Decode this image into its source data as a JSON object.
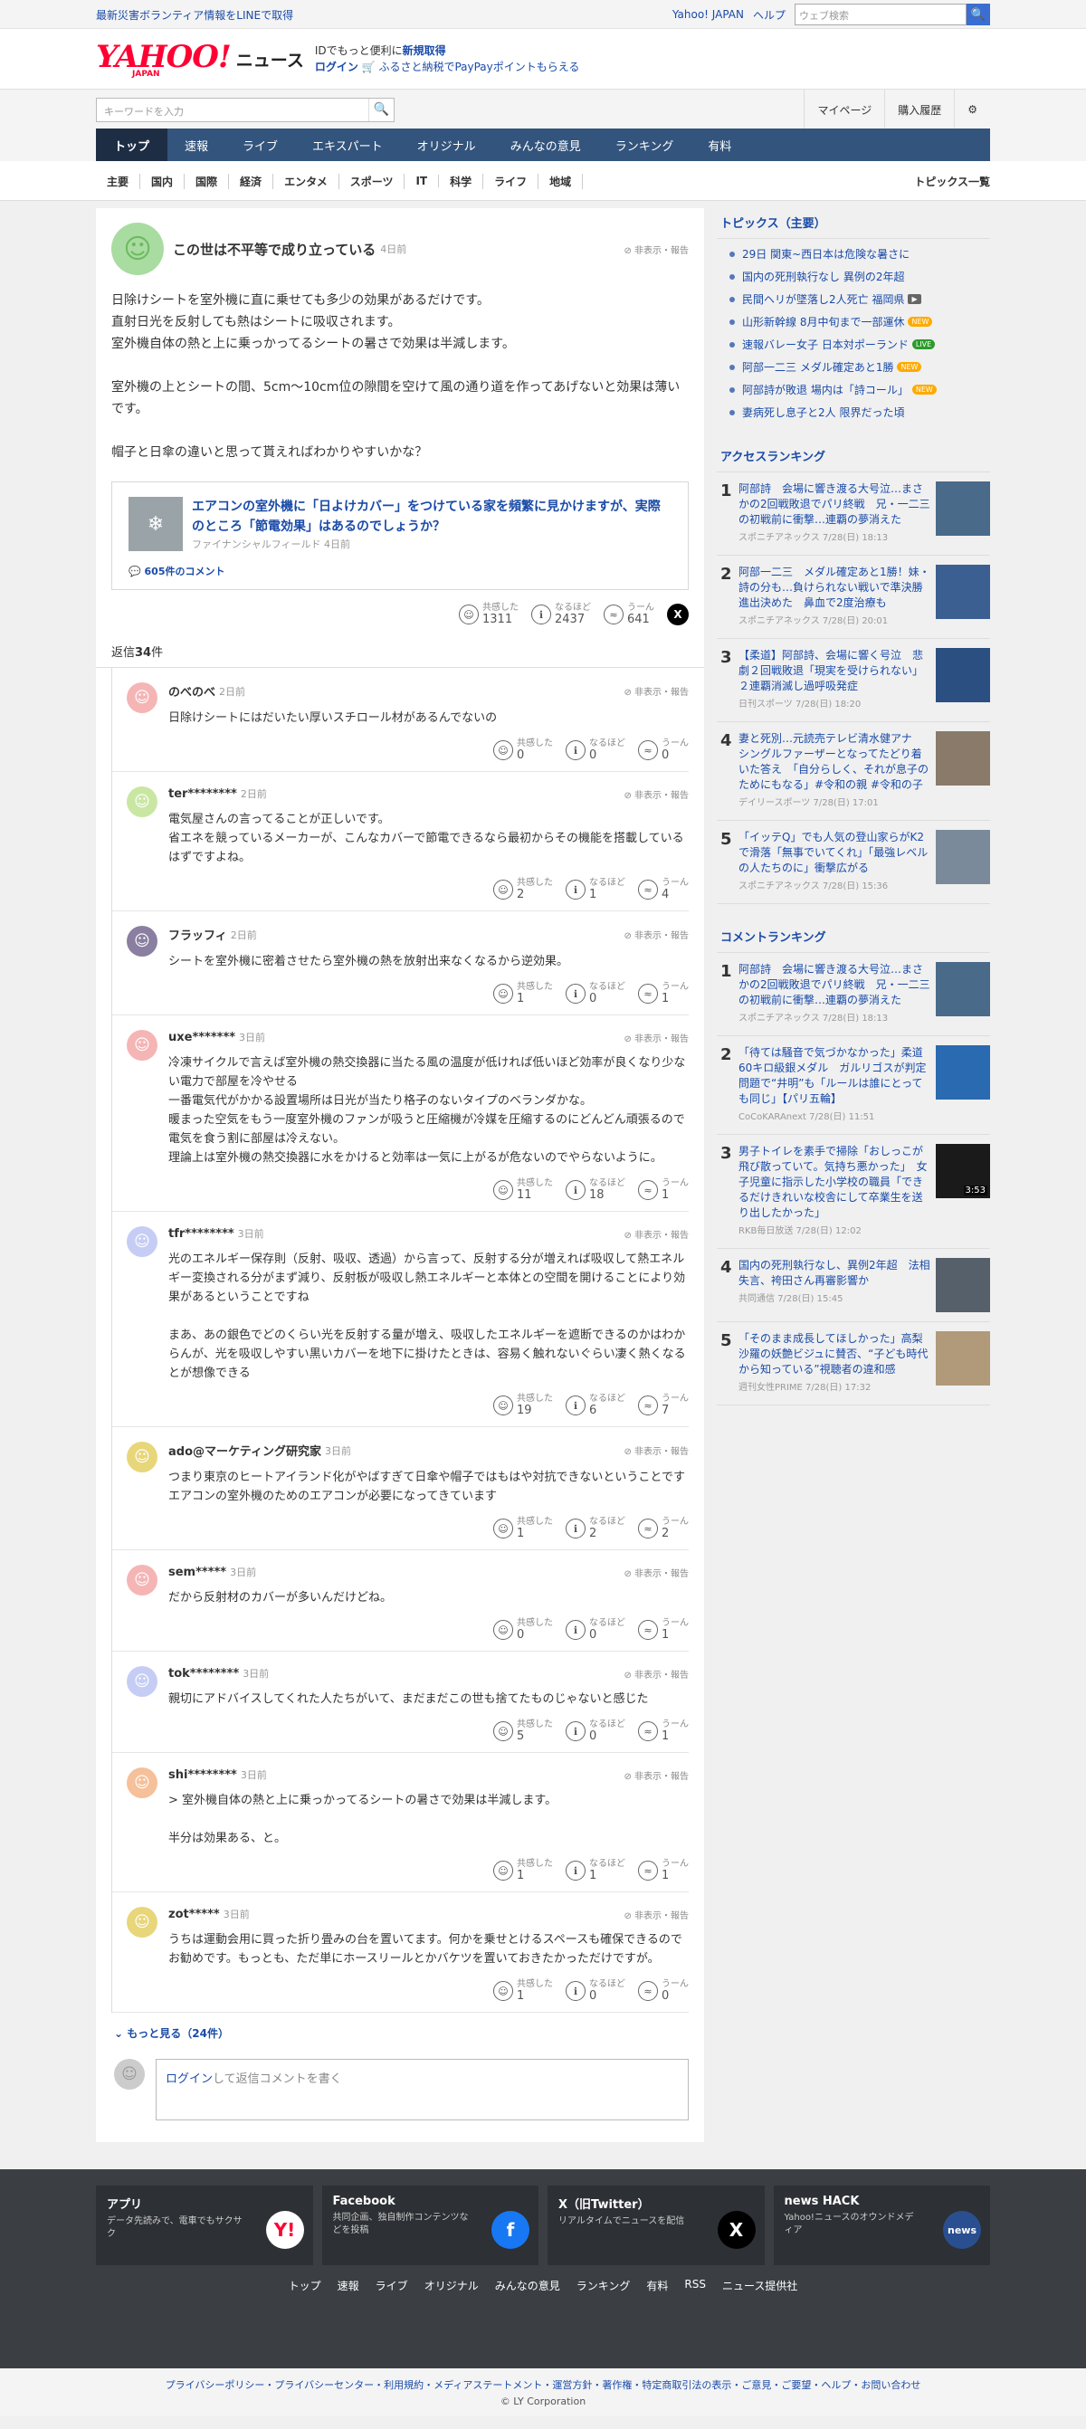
{
  "topbar": {
    "disaster_link": "最新災害ボランティア情報をLINEで取得",
    "yahoo_japan": "Yahoo! JAPAN",
    "help": "ヘルプ",
    "web_search_placeholder": "ウェブ検索"
  },
  "header": {
    "logo": "YAHOO!",
    "logo_sub": "JAPAN",
    "news_label": "ニュース",
    "line1_pre": "IDでもっと便利に",
    "line1_link": "新規取得",
    "line2_login": "ログイン",
    "line2_text": "ふるさと納税でPayPayポイントもらえる"
  },
  "searchbar": {
    "placeholder": "キーワードを入力",
    "mypage": "マイページ",
    "history": "購入履歴"
  },
  "nav": {
    "tabs": [
      "トップ",
      "速報",
      "ライブ",
      "エキスパート",
      "オリジナル",
      "みんなの意見",
      "ランキング",
      "有料"
    ]
  },
  "subnav": {
    "cats": [
      "主要",
      "国内",
      "国際",
      "経済",
      "エンタメ",
      "スポーツ",
      "IT",
      "科学",
      "ライフ",
      "地域"
    ],
    "more": "トピックス一覧"
  },
  "post": {
    "title": "この世は不平等で成り立っている",
    "time": "4日前",
    "hide": "非表示・報告",
    "p1a": "日除けシートを室外機に直に乗せても多少の効果があるだけです。",
    "p1b": "直射日光を反射しても熱はシートに吸収されます。",
    "p1c": "室外機自体の熱と上に乗っかってるシートの暑さで効果は半減します。",
    "p2": "室外機の上とシートの間、5cm〜10cm位の隙間を空けて風の通り道を作ってあげないと効果は薄いです。",
    "p3": "帽子と日傘の違いと思って貰えればわかりやすいかな？",
    "article_title": "エアコンの室外機に「日よけカバー」をつけている家を頻繁に見かけますが、実際のところ「節電効果」はあるのでしょうか？",
    "article_meta": "ファイナンシャルフィールド 4日前",
    "article_comments": "605件のコメント",
    "r_kyokan_label": "共感した",
    "r_kyokan": "1311",
    "r_naruhodo_label": "なるほど",
    "r_naruhodo": "2437",
    "r_un_label": "うーん",
    "r_un": "641",
    "x_label": "X"
  },
  "replies_count_pre": "返信",
  "replies_count": "34",
  "replies_count_post": "件",
  "replies": [
    {
      "name": "のべのべ",
      "time": "2日前",
      "text": [
        "日除けシートにはだいたい厚いスチロール材があるんでないの"
      ],
      "k": "0",
      "n": "0",
      "u": "0",
      "color": "#f5b5b5"
    },
    {
      "name": "ter********",
      "time": "2日前",
      "text": [
        "電気屋さんの言ってることが正しいです。\n省エネを競っているメーカーが、こんなカバーで節電できるなら最初からその機能を搭載しているはずですよね。"
      ],
      "k": "2",
      "n": "1",
      "u": "4",
      "color": "#c9e7a3"
    },
    {
      "name": "フラッフィ",
      "time": "2日前",
      "text": [
        "シートを室外機に密着させたら室外機の熱を放射出来なくなるから逆効果。"
      ],
      "k": "1",
      "n": "0",
      "u": "1",
      "color": "#8a7fa0"
    },
    {
      "name": "uxe*******",
      "time": "3日前",
      "text": [
        "冷凍サイクルで言えば室外機の熱交換器に当たる風の温度が低ければ低いほど効率が良くなり少ない電力で部屋を冷やせる\n一番電気代がかかる設置場所は日光が当たり格子のないタイプのベランダかな。\n暖まった空気をもう一度室外機のファンが吸うと圧縮機が冷媒を圧縮するのにどんどん頑張るので電気を食う割に部屋は冷えない。\n理論上は室外機の熱交換器に水をかけると効率は一気に上がるが危ないのでやらないように。"
      ],
      "k": "11",
      "n": "18",
      "u": "1",
      "color": "#f5b5b5"
    },
    {
      "name": "tfr********",
      "time": "3日前",
      "text": [
        "光のエネルギー保存則（反射、吸収、透過）から言って、反射する分が増えれば吸収して熱エネルギー変換される分がまず減り、反射板が吸収し熱エネルギーと本体との空間を開けることにより効果があるということですね",
        "まあ、あの銀色でどのくらい光を反射する量が増え、吸収したエネルギーを遮断できるのかはわからんが、光を吸収しやすい黒いカバーを地下に掛けたときは、容易く触れないぐらい凄く熱くなるとが想像できる"
      ],
      "k": "19",
      "n": "6",
      "u": "7",
      "color": "#c6cdf5"
    },
    {
      "name": "ado@マーケティング研究家",
      "time": "3日前",
      "text": [
        "つまり東京のヒートアイランド化がやばすぎて日傘や帽子ではもはや対抗できないということです\nエアコンの室外機のためのエアコンが必要になってきています"
      ],
      "k": "1",
      "n": "2",
      "u": "2",
      "color": "#e8d67a"
    },
    {
      "name": "sem*****",
      "time": "3日前",
      "text": [
        "だから反射材のカバーが多いんだけどね。"
      ],
      "k": "0",
      "n": "0",
      "u": "1",
      "color": "#f5b5b5"
    },
    {
      "name": "tok********",
      "time": "3日前",
      "text": [
        "親切にアドバイスしてくれた人たちがいて、まだまだこの世も捨てたものじゃないと感じた"
      ],
      "k": "5",
      "n": "0",
      "u": "1",
      "color": "#c6cdf5"
    },
    {
      "name": "shi********",
      "time": "3日前",
      "text": [
        "> 室外機自体の熱と上に乗っかってるシートの暑さで効果は半減します。",
        "半分は効果ある、と。"
      ],
      "k": "1",
      "n": "1",
      "u": "1",
      "color": "#f5c09a"
    },
    {
      "name": "zot*****",
      "time": "3日前",
      "text": [
        "うちは運動会用に買った折り畳みの台を置いてます。何かを乗せとけるスペースも確保できるのでお勧めです。もっとも、ただ単にホースリールとかバケツを置いておきたかっただけですが。"
      ],
      "k": "1",
      "n": "0",
      "u": "0",
      "color": "#e8d67a"
    }
  ],
  "reply_labels": {
    "kyokan": "共感した",
    "naruhodo": "なるほど",
    "un": "うーん",
    "hide": "非表示・報告"
  },
  "more_link": "もっと見る",
  "more_count": "（24件）",
  "reply_box": {
    "login": "ログイン",
    "text": "して返信コメントを書く"
  },
  "sidebar": {
    "topics_title": "トピックス（主要）",
    "topics": [
      {
        "t": "29日 関東~西日本は危険な暑さに",
        "tag": ""
      },
      {
        "t": "国内の死刑執行なし 異例の2年超",
        "tag": ""
      },
      {
        "t": "民間ヘリが墜落し2人死亡 福岡県",
        "tag": "vid"
      },
      {
        "t": "山形新幹線 8月中旬まで一部運休",
        "tag": "NEW"
      },
      {
        "t": "速報バレー女子 日本対ポーランド",
        "tag": "LIVE"
      },
      {
        "t": "阿部一二三 メダル確定あと1勝",
        "tag": "NEW"
      },
      {
        "t": "阿部詩が敗退 場内は「詩コール」",
        "tag": "NEW"
      },
      {
        "t": "妻病死し息子と2人 限界だった頃",
        "tag": ""
      }
    ],
    "access_title": "アクセスランキング",
    "access": [
      {
        "no": "1",
        "t": "阿部詩　会場に響き渡る大号泣…まさかの2回戦敗退でパリ終戦　兄・一二三の初戦前に衝撃…連覇の夢消えた",
        "src": "スポニチアネックス 7/28(日) 18:13",
        "c": "#4a6a8a"
      },
      {
        "no": "2",
        "t": "阿部一二三　メダル確定あと1勝！妹・詩の分も…負けられない戦いで準決勝進出決めた　鼻血で2度治療も",
        "src": "スポニチアネックス 7/28(日) 20:01",
        "c": "#3a5f90"
      },
      {
        "no": "3",
        "t": "【柔道】阿部詩、会場に響く号泣　悲劇２回戦敗退「現実を受けられない」２連覇消滅し過呼吸発症",
        "src": "日刊スポーツ 7/28(日) 18:20",
        "c": "#2a4f80"
      },
      {
        "no": "4",
        "t": "妻と死別…元読売テレビ清水健アナ　シングルファーザーとなってたどり着いた答え　「自分らしく、それが息子のためにもなる」#令和の親 #令和の子",
        "src": "デイリースポーツ 7/28(日) 17:01",
        "c": "#8a7a6a"
      },
      {
        "no": "5",
        "t": "「イッテQ」でも人気の登山家らがK2で滑落「無事でいてくれ」「最強レベルの人たちのに」衝撃広がる",
        "src": "スポニチアネックス 7/28(日) 15:36",
        "c": "#7a8a9a"
      }
    ],
    "comment_title": "コメントランキング",
    "comment": [
      {
        "no": "1",
        "t": "阿部詩　会場に響き渡る大号泣…まさかの2回戦敗退でパリ終戦　兄・一二三の初戦前に衝撃…連覇の夢消えた",
        "src": "スポニチアネックス 7/28(日) 18:13",
        "c": "#4a6a8a"
      },
      {
        "no": "2",
        "t": "「待ては騒音で気づかなかった」柔道60キロ級銀メダル　ガルリゴスが判定問題で“井明”も「ルールは誰にとっても同じ」【パリ五輪】",
        "src": "CoCoKARAnext 7/28(日) 11:51",
        "c": "#2a6ab0"
      },
      {
        "no": "3",
        "t": "男子トイレを素手で掃除「おしっこが飛び散っていて。気持ち悪かった」　女子児童に指示した小学校の職員「できるだけきれいな校舎にして卒業生を送り出したかった」",
        "src": "RKB毎日放送 7/28(日) 12:02",
        "c": "#1a1a1a"
      },
      {
        "no": "4",
        "t": "国内の死刑執行なし、異例2年超　法相失言、袴田さん再審影響か",
        "src": "共同通信 7/28(日) 15:45",
        "c": "#55606a"
      },
      {
        "no": "5",
        "t": "「そのまま成長してほしかった」高梨沙羅の妖艶ビジュに賛否、“子ども時代から知っている”視聴者の違和感",
        "src": "週刊女性PRIME 7/28(日) 17:32",
        "c": "#b09a7a"
      }
    ],
    "video_time": "3:53"
  },
  "footer": {
    "cards": [
      {
        "t": "アプリ",
        "d": "データ先読みで、電車でもサクサク",
        "c": "#fff"
      },
      {
        "t": "Facebook",
        "d": "共同企画、独自制作コンテンツなどを投稿",
        "c": "#1877f2"
      },
      {
        "t": "X（旧Twitter）",
        "d": "リアルタイムでニュースを配信",
        "c": "#000"
      },
      {
        "t": "news HACK",
        "d": "Yahoo!ニュースのオウンドメディア",
        "c": "#2a4f90"
      }
    ],
    "nav": [
      "トップ",
      "速報",
      "ライブ",
      "オリジナル",
      "みんなの意見",
      "ランキング",
      "有料",
      "RSS",
      "ニュース提供社"
    ],
    "legal": "プライバシーポリシー・プライバシーセンター・利用規約・メディアステートメント・運営方針・著作権・特定商取引法の表示・ご意見・ご要望・ヘルプ・お問い合わせ",
    "copyright": "© LY Corporation"
  }
}
